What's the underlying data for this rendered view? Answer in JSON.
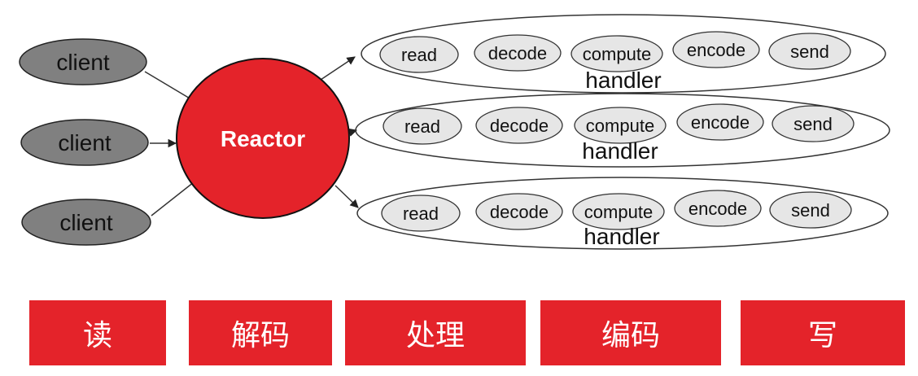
{
  "clients": [
    "client",
    "client",
    "client"
  ],
  "reactor": {
    "label": "Reactor"
  },
  "handlers": [
    {
      "label": "handler",
      "steps": [
        "read",
        "decode",
        "compute",
        "encode",
        "send"
      ]
    },
    {
      "label": "handler",
      "steps": [
        "read",
        "decode",
        "compute",
        "encode",
        "send"
      ]
    },
    {
      "label": "handler",
      "steps": [
        "read",
        "decode",
        "compute",
        "encode",
        "send"
      ]
    }
  ],
  "stages": [
    "读",
    "解码",
    "处理",
    "编码",
    "写"
  ],
  "colors": {
    "reactor": "#e4232a",
    "client": "#808080",
    "step": "#e6e6e6",
    "stage_bar": "#e4232a"
  }
}
